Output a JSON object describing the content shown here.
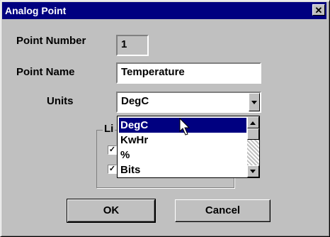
{
  "window": {
    "title": "Analog Point",
    "close_glyph": "✕"
  },
  "form": {
    "point_number_label": "Point Number",
    "point_number_value": "1",
    "point_name_label": "Point Name",
    "point_name_value": "Temperature",
    "units_label": "Units",
    "units_selected": "DegC"
  },
  "groupbox": {
    "legend_fragment": "Li"
  },
  "dropdown": {
    "options": [
      "DegC",
      "KwHr",
      "%",
      "Bits"
    ],
    "selected_index": 0,
    "scroll_position": 0
  },
  "buttons": {
    "ok": "OK",
    "cancel": "Cancel"
  },
  "icons": {
    "close": "close-icon",
    "dropdown_arrow": "chevron-down-icon",
    "scroll_up": "arrow-up-icon",
    "scroll_down": "arrow-down-icon",
    "check": "checkmark-icon",
    "cursor": "mouse-pointer-icon"
  },
  "colors": {
    "title_bar": "#000080",
    "dialog_face": "#c0c0c0",
    "selection": "#000080"
  }
}
